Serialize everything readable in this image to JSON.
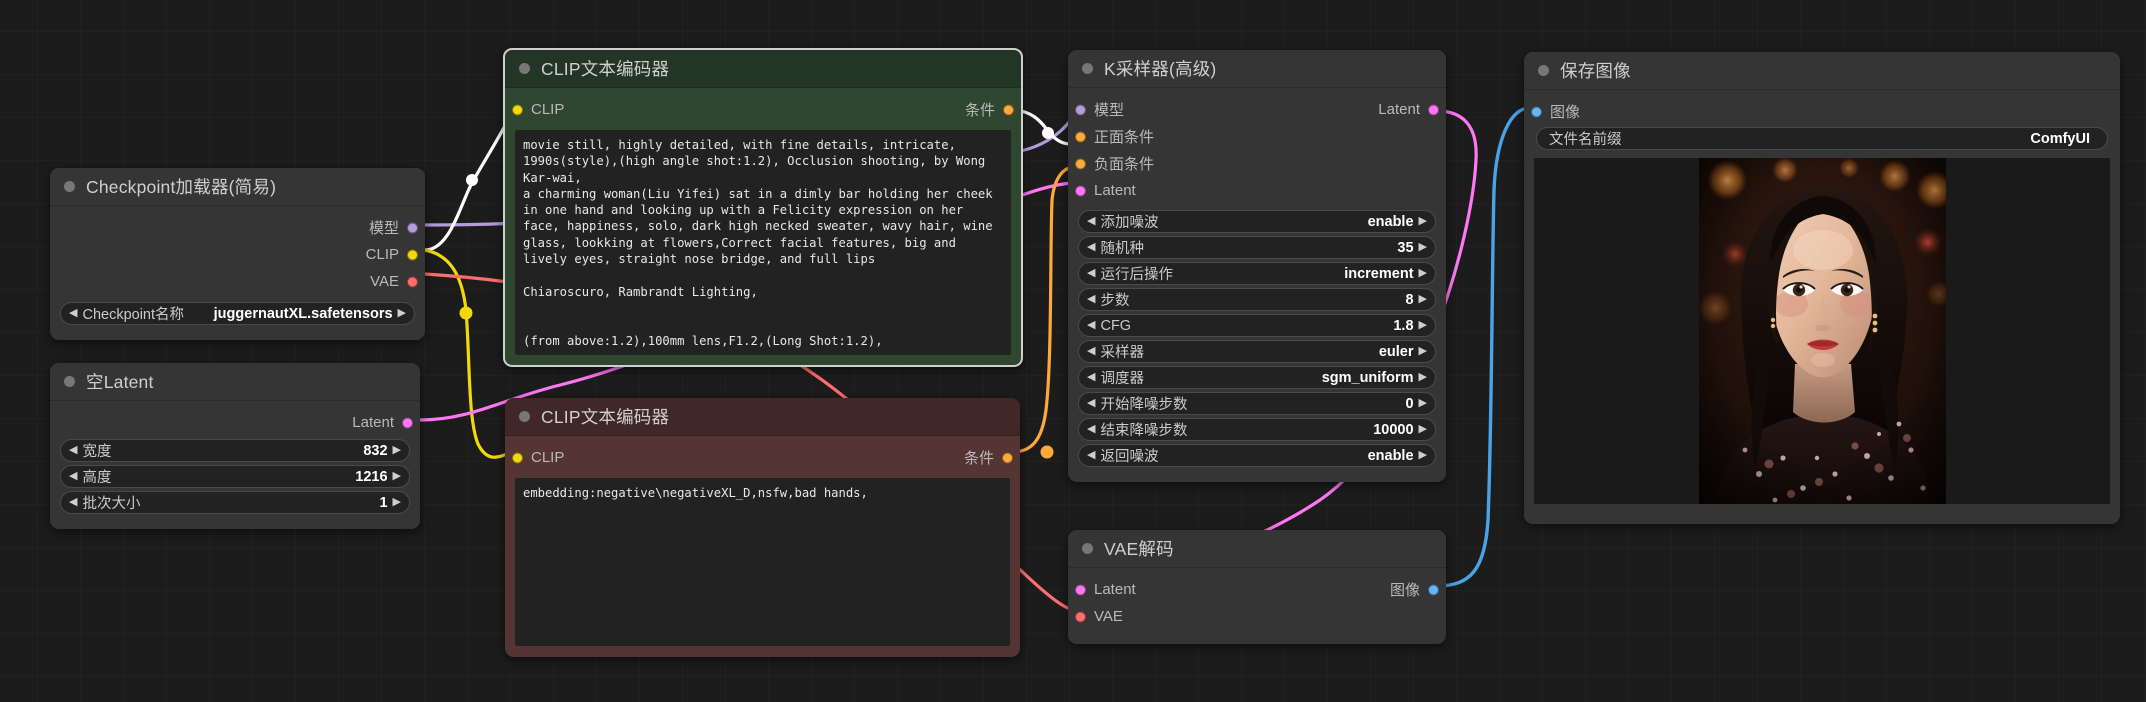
{
  "app": "ComfyUI",
  "canvas": {
    "background": "#1c1c1c",
    "grid": true
  },
  "nodes": {
    "checkpoint_loader": {
      "title": "Checkpoint加载器(简易)",
      "outputs": [
        {
          "label": "模型",
          "color": "#b39ddb"
        },
        {
          "label": "CLIP",
          "color": "#f4d90a"
        },
        {
          "label": "VAE",
          "color": "#ff6e6e"
        }
      ],
      "widgets": [
        {
          "name": "Checkpoint名称",
          "value": "juggernautXL.safetensors"
        }
      ]
    },
    "empty_latent": {
      "title": "空Latent",
      "outputs": [
        {
          "label": "Latent",
          "color": "#ff77f4"
        }
      ],
      "widgets": [
        {
          "name": "宽度",
          "value": "832"
        },
        {
          "name": "高度",
          "value": "1216"
        },
        {
          "name": "批次大小",
          "value": "1"
        }
      ]
    },
    "clip_positive": {
      "title": "CLIP文本编码器",
      "accent": "#2f4631",
      "inputs": [
        {
          "label": "CLIP",
          "color": "#f4d90a"
        }
      ],
      "outputs": [
        {
          "label": "条件",
          "color": "#ffa93a"
        }
      ],
      "text": "movie still, highly detailed, with fine details, intricate,\n1990s(style),(high angle shot:1.2), Occlusion shooting, by Wong\nKar-wai,\na charming woman(Liu Yifei) sat in a dimly bar holding her cheek\nin one hand and looking up with a Felicity expression on her\nface, happiness, solo, dark high necked sweater, wavy hair, wine\nglass, lookking at flowers,Correct facial features, big and\nlively eyes, straight nose bridge, and full lips\n\nChiaroscuro, Rambrandt Lighting,\n\n\n(from above:1.2),100mm lens,F1.2,(Long Shot:1.2),"
    },
    "clip_negative": {
      "title": "CLIP文本编码器",
      "accent": "#553434",
      "inputs": [
        {
          "label": "CLIP",
          "color": "#f4d90a"
        }
      ],
      "outputs": [
        {
          "label": "条件",
          "color": "#ffa93a"
        }
      ],
      "text": "embedding:negative\\negativeXL_D,nsfw,bad hands,"
    },
    "ksampler": {
      "title": "K采样器(高级)",
      "inputs": [
        {
          "label": "模型",
          "color": "#b39ddb"
        },
        {
          "label": "正面条件",
          "color": "#ffa93a"
        },
        {
          "label": "负面条件",
          "color": "#ffa93a"
        },
        {
          "label": "Latent",
          "color": "#ff77f4"
        }
      ],
      "outputs": [
        {
          "label": "Latent",
          "color": "#ff77f4"
        }
      ],
      "widgets": [
        {
          "name": "添加噪波",
          "value": "enable"
        },
        {
          "name": "随机种",
          "value": "35"
        },
        {
          "name": "运行后操作",
          "value": "increment"
        },
        {
          "name": "步数",
          "value": "8"
        },
        {
          "name": "CFG",
          "value": "1.8"
        },
        {
          "name": "采样器",
          "value": "euler"
        },
        {
          "name": "调度器",
          "value": "sgm_uniform"
        },
        {
          "name": "开始降噪步数",
          "value": "0"
        },
        {
          "name": "结束降噪步数",
          "value": "10000"
        },
        {
          "name": "返回噪波",
          "value": "enable"
        }
      ]
    },
    "vae_decode": {
      "title": "VAE解码",
      "inputs": [
        {
          "label": "Latent",
          "color": "#ff77f4"
        },
        {
          "label": "VAE",
          "color": "#ff6e6e"
        }
      ],
      "outputs": [
        {
          "label": "图像",
          "color": "#64b5f6"
        }
      ]
    },
    "save_image": {
      "title": "保存图像",
      "inputs": [
        {
          "label": "图像",
          "color": "#64b5f6"
        }
      ],
      "widgets": [
        {
          "name": "文件名前缀",
          "value": "ComfyUI"
        }
      ]
    }
  },
  "links": [
    {
      "from": "checkpoint_loader.模型",
      "to": "ksampler.模型",
      "color": "#b39ddb"
    },
    {
      "from": "checkpoint_loader.CLIP",
      "to": "clip_positive.CLIP",
      "color": "#f4d90a"
    },
    {
      "from": "checkpoint_loader.CLIP",
      "to": "clip_negative.CLIP",
      "color": "#f4d90a"
    },
    {
      "from": "checkpoint_loader.VAE",
      "to": "vae_decode.VAE",
      "color": "#ff6e6e"
    },
    {
      "from": "empty_latent.Latent",
      "to": "ksampler.Latent",
      "color": "#ff77f4"
    },
    {
      "from": "clip_positive.条件",
      "to": "ksampler.正面条件",
      "color": "#ffffff"
    },
    {
      "from": "clip_negative.条件",
      "to": "ksampler.负面条件",
      "color": "#ffa93a"
    },
    {
      "from": "ksampler.Latent",
      "to": "vae_decode.Latent",
      "color": "#ff77f4"
    },
    {
      "from": "vae_decode.图像",
      "to": "save_image.图像",
      "color": "#4aa3e8"
    }
  ]
}
